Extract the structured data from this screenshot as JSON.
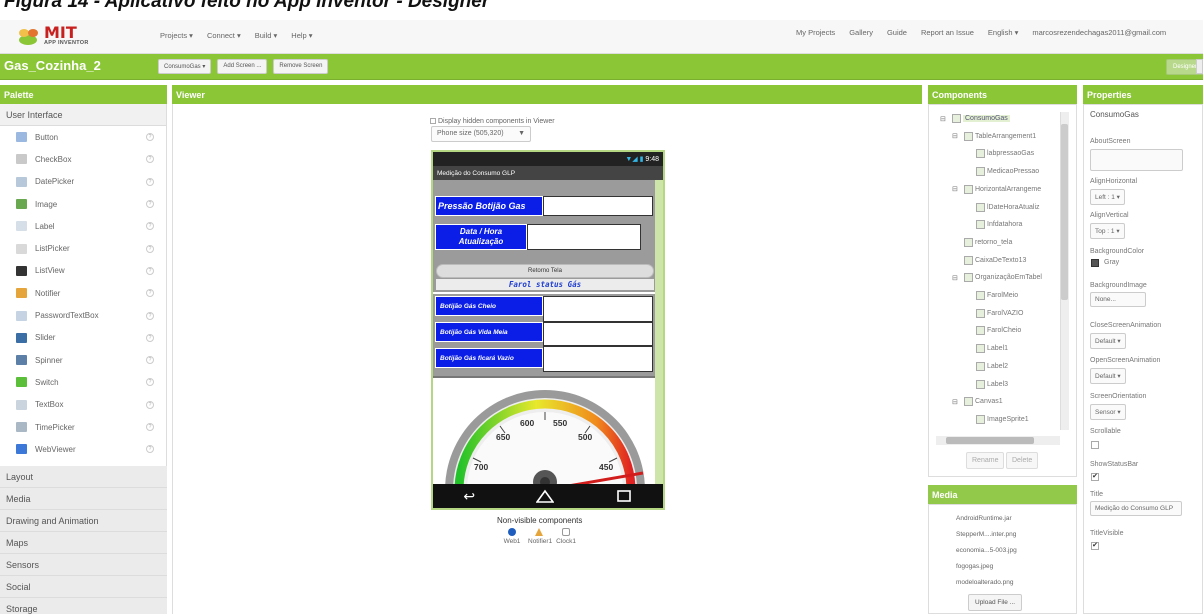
{
  "page_caption": "Figura 14 - Aplicativo feito no App Inventor - Designer",
  "logo": {
    "brand": "MIT",
    "sub": "APP INVENTOR"
  },
  "nav_left": [
    "Projects ▾",
    "Connect ▾",
    "Build ▾",
    "Help ▾"
  ],
  "nav_right": [
    "My Projects",
    "Gallery",
    "Guide",
    "Report an Issue",
    "English ▾",
    "marcosrezendechagas2011@gmail.com"
  ],
  "project": {
    "name": "Gas_Cozinha_2",
    "screen_dropdown": "ConsumoGas ▾",
    "add_screen": "Add Screen ...",
    "remove_screen": "Remove Screen",
    "designer": "Designer"
  },
  "palette": {
    "title": "Palette",
    "open_category": "User Interface",
    "items": [
      {
        "label": "Button",
        "icon": "button-icon",
        "color": "#9ab8e0"
      },
      {
        "label": "CheckBox",
        "icon": "checkbox-icon",
        "color": "#c9c9c9"
      },
      {
        "label": "DatePicker",
        "icon": "datepicker-icon",
        "color": "#b7c8da"
      },
      {
        "label": "Image",
        "icon": "image-icon",
        "color": "#6aa84f"
      },
      {
        "label": "Label",
        "icon": "label-icon",
        "color": "#d6dfe8"
      },
      {
        "label": "ListPicker",
        "icon": "listpicker-icon",
        "color": "#d9d9d9"
      },
      {
        "label": "ListView",
        "icon": "listview-icon",
        "color": "#333333"
      },
      {
        "label": "Notifier",
        "icon": "notifier-icon",
        "color": "#e6a53b"
      },
      {
        "label": "PasswordTextBox",
        "icon": "password-icon",
        "color": "#c5d3e3"
      },
      {
        "label": "Slider",
        "icon": "slider-icon",
        "color": "#3a6ea5"
      },
      {
        "label": "Spinner",
        "icon": "spinner-icon",
        "color": "#5b7fa6"
      },
      {
        "label": "Switch",
        "icon": "switch-icon",
        "color": "#5bbf3a"
      },
      {
        "label": "TextBox",
        "icon": "textbox-icon",
        "color": "#c9d4df"
      },
      {
        "label": "TimePicker",
        "icon": "timepicker-icon",
        "color": "#aab8c6"
      },
      {
        "label": "WebViewer",
        "icon": "webviewer-icon",
        "color": "#3c78d8"
      }
    ],
    "categories": [
      "Layout",
      "Media",
      "Drawing and Animation",
      "Maps",
      "Sensors",
      "Social",
      "Storage"
    ]
  },
  "viewer": {
    "title": "Viewer",
    "hidden_checkbox": "Display hidden components in Viewer",
    "phone_size": "Phone size (505,320)",
    "status_time": "9:48",
    "app_title": "Medição do Consumo GLP",
    "pressure_label": "Pressão Botijão Gas",
    "datetime_label": "Data / Hora Atualização",
    "back_button": "Retorno Tela",
    "farol_label": "Farol status Gás",
    "status_rows": [
      "Botijão Gás Cheio",
      "Botijão Gás Vida Meia",
      "Botijão Gás ficará Vazio"
    ],
    "gauge_labels": [
      "600",
      "550",
      "650",
      "500",
      "700",
      "450"
    ],
    "nonvisible_title": "Non-visible components",
    "nonvisible": [
      "Web1",
      "Notifier1",
      "Clock1"
    ]
  },
  "components": {
    "title": "Components",
    "tree": [
      {
        "label": "ConsumoGas",
        "depth": 0,
        "expander": "⊟"
      },
      {
        "label": "TableArrangement1",
        "depth": 1,
        "expander": "⊟"
      },
      {
        "label": "labpressaoGas",
        "depth": 2
      },
      {
        "label": "MedicaoPressao",
        "depth": 2
      },
      {
        "label": "HorizontalArrangeme",
        "depth": 1,
        "expander": "⊟"
      },
      {
        "label": "lDateHoraAtualiz",
        "depth": 2
      },
      {
        "label": "Infdatahora",
        "depth": 2
      },
      {
        "label": "retorno_tela",
        "depth": 1
      },
      {
        "label": "CaixaDeTexto13",
        "depth": 1
      },
      {
        "label": "OrganizaçãoEmTabel",
        "depth": 1,
        "expander": "⊟"
      },
      {
        "label": "FarolMeio",
        "depth": 2
      },
      {
        "label": "FarolVAZIO",
        "depth": 2
      },
      {
        "label": "FarolCheio",
        "depth": 2
      },
      {
        "label": "Label1",
        "depth": 2
      },
      {
        "label": "Label2",
        "depth": 2
      },
      {
        "label": "Label3",
        "depth": 2
      },
      {
        "label": "Canvas1",
        "depth": 1,
        "expander": "⊟"
      },
      {
        "label": "ImageSprite1",
        "depth": 2
      }
    ],
    "rename": "Rename",
    "delete": "Delete"
  },
  "media": {
    "title": "Media",
    "files": [
      "AndroidRuntime.jar",
      "StepperM....inter.png",
      "economia...5-003.jpg",
      "fogogas.jpeg",
      "modeloalterado.png"
    ],
    "upload": "Upload File ..."
  },
  "properties": {
    "title": "Properties",
    "component": "ConsumoGas",
    "fields": [
      {
        "label": "AboutScreen",
        "value": ""
      },
      {
        "label": "AlignHorizontal",
        "value": "Left : 1 ▾"
      },
      {
        "label": "AlignVertical",
        "value": "Top : 1 ▾"
      },
      {
        "label": "BackgroundColor",
        "value": "Gray"
      },
      {
        "label": "BackgroundImage",
        "value": "None..."
      },
      {
        "label": "CloseScreenAnimation",
        "value": "Default ▾"
      },
      {
        "label": "OpenScreenAnimation",
        "value": "Default ▾"
      },
      {
        "label": "ScreenOrientation",
        "value": "Sensor ▾"
      },
      {
        "label": "Scrollable",
        "value": ""
      },
      {
        "label": "ShowStatusBar",
        "value": "✔"
      },
      {
        "label": "Title",
        "value": "Medição do Consumo GLP"
      },
      {
        "label": "TitleVisible",
        "value": "✔"
      }
    ]
  },
  "colors": {
    "accent_green": "#8bc637",
    "screen_gray": "#9b9b9b",
    "label_blue": "#0a1ee8"
  }
}
